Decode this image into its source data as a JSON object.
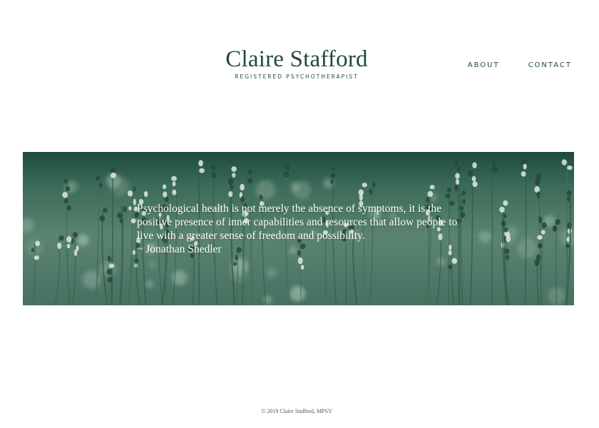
{
  "header": {
    "name": "Claire Stafford",
    "subtitle": "REGISTERED PSYCHOTHERAPIST",
    "nav": [
      "ABOUT",
      "CONTACT"
    ]
  },
  "hero": {
    "quote": "Psychological health is not merely the absence of symptoms, it is the positive presence of inner capabilities and resources that allow people to live with a greater sense of freedom and possibility.",
    "attribution": "~ Jonathan Shedler"
  },
  "footer": {
    "copyright": "© 2019 Claire Stafford, MPSY"
  },
  "colors": {
    "brand": "#1f4a3d",
    "hero_dark": "#1c4a3e",
    "hero_mid": "#5a8470"
  },
  "icons": {
    "hero_image": "wildflower-meadow-photo"
  }
}
